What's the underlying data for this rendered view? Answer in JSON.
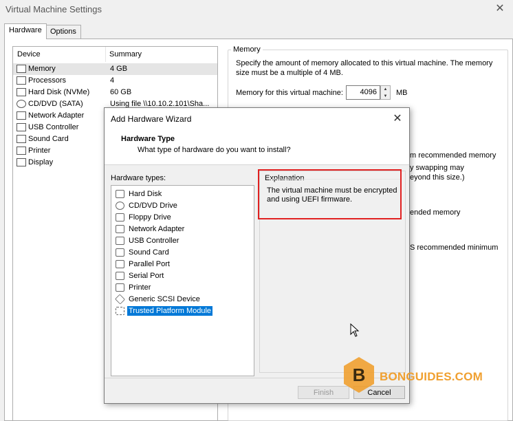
{
  "window": {
    "title": "Virtual Machine Settings"
  },
  "tabs": [
    {
      "label": "Hardware"
    },
    {
      "label": "Options"
    }
  ],
  "device_list": {
    "headers": {
      "device": "Device",
      "summary": "Summary"
    },
    "rows": [
      {
        "name": "Memory",
        "summary": "4 GB"
      },
      {
        "name": "Processors",
        "summary": "4"
      },
      {
        "name": "Hard Disk (NVMe)",
        "summary": "60 GB"
      },
      {
        "name": "CD/DVD (SATA)",
        "summary": "Using file \\\\10.10.2.101\\Sha..."
      },
      {
        "name": "Network Adapter",
        "summary": ""
      },
      {
        "name": "USB Controller",
        "summary": ""
      },
      {
        "name": "Sound Card",
        "summary": ""
      },
      {
        "name": "Printer",
        "summary": ""
      },
      {
        "name": "Display",
        "summary": ""
      }
    ]
  },
  "memory": {
    "legend": "Memory",
    "description": "Specify the amount of memory allocated to this virtual machine. The memory size must be a multiple of 4 MB.",
    "field_label": "Memory for this virtual machine:",
    "value": "4096",
    "unit": "MB",
    "bg_fragments": [
      "m recommended memory",
      "y swapping may",
      "eyond this size.)",
      "ended memory",
      "S recommended minimum"
    ]
  },
  "dialog": {
    "title": "Add Hardware Wizard",
    "header_title": "Hardware Type",
    "header_subtitle": "What type of hardware do you want to install?",
    "list_label": "Hardware types:",
    "items": [
      {
        "label": "Hard Disk"
      },
      {
        "label": "CD/DVD Drive"
      },
      {
        "label": "Floppy Drive"
      },
      {
        "label": "Network Adapter"
      },
      {
        "label": "USB Controller"
      },
      {
        "label": "Sound Card"
      },
      {
        "label": "Parallel Port"
      },
      {
        "label": "Serial Port"
      },
      {
        "label": "Printer"
      },
      {
        "label": "Generic SCSI Device"
      },
      {
        "label": "Trusted Platform Module"
      }
    ],
    "explanation_legend": "Explanation",
    "explanation_text": "The virtual machine must be encrypted and using UEFI firmware.",
    "finish_label": "Finish",
    "cancel_label": "Cancel"
  },
  "watermark": {
    "text": "BONGUIDES.COM",
    "letter": "B"
  },
  "colors": {
    "selection": "#0078d7",
    "highlight_box": "#e02020",
    "watermark": "#f0a030"
  }
}
